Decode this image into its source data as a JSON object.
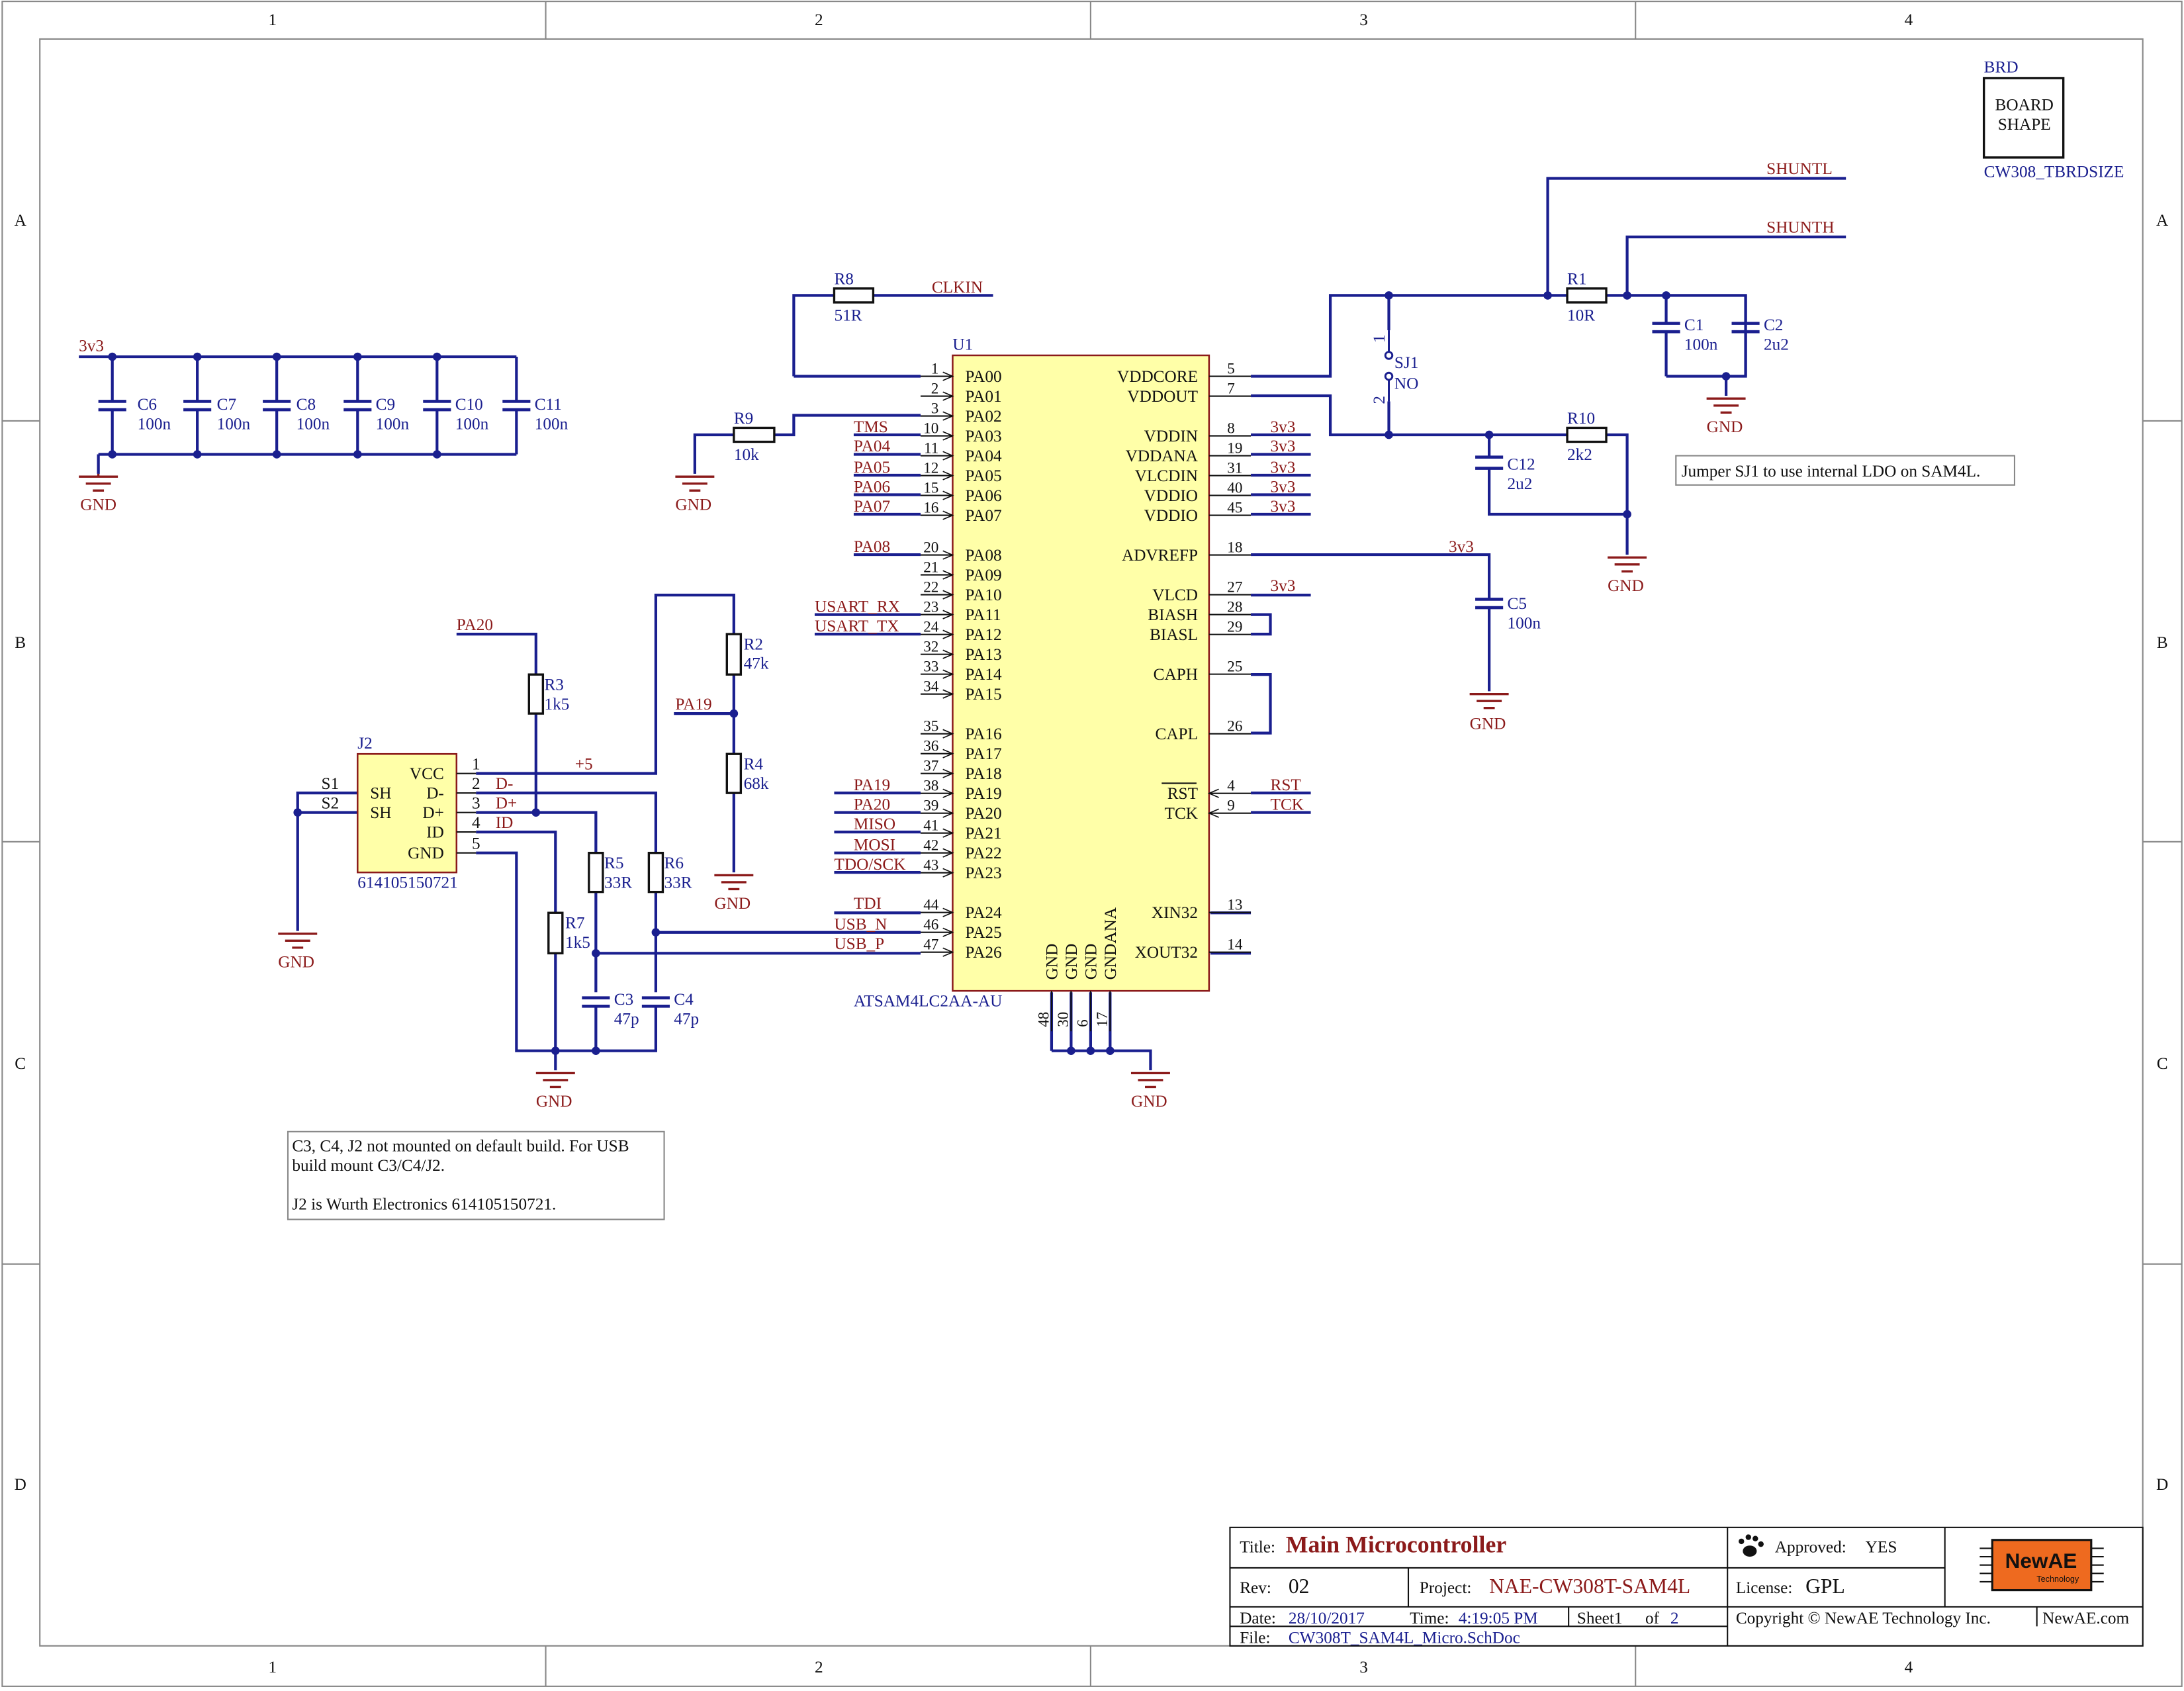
{
  "frame": {
    "cols": [
      "1",
      "2",
      "3",
      "4"
    ],
    "rows": [
      "A",
      "B",
      "C",
      "D"
    ]
  },
  "board": {
    "designator": "BRD",
    "line1": "BOARD",
    "line2": "SHAPE",
    "part": "CW308_TBRDSIZE"
  },
  "nets": {
    "v3v3": "3v3",
    "gnd": "GND",
    "clkin": "CLKIN",
    "shuntl": "SHUNTL",
    "shunth": "SHUNTH",
    "tms": "TMS",
    "pa04": "PA04",
    "pa05": "PA05",
    "pa06": "PA06",
    "pa07": "PA07",
    "pa08": "PA08",
    "usart_rx": "USART_RX",
    "usart_tx": "USART_TX",
    "pa19": "PA19",
    "pa20": "PA20",
    "miso": "MISO",
    "mosi": "MOSI",
    "tdo": "TDO/SCK",
    "tdi": "TDI",
    "usb_n": "USB_N",
    "usb_p": "USB_P",
    "rst": "RST",
    "tck": "TCK",
    "plus5": "+5",
    "dminus": "D-",
    "dplus": "D+",
    "id": "ID"
  },
  "decoupling": [
    {
      "ref": "C6",
      "value": "100n"
    },
    {
      "ref": "C7",
      "value": "100n"
    },
    {
      "ref": "C8",
      "value": "100n"
    },
    {
      "ref": "C9",
      "value": "100n"
    },
    {
      "ref": "C10",
      "value": "100n"
    },
    {
      "ref": "C11",
      "value": "100n"
    }
  ],
  "components": {
    "R8": {
      "ref": "R8",
      "value": "51R"
    },
    "R9": {
      "ref": "R9",
      "value": "10k"
    },
    "R2": {
      "ref": "R2",
      "value": "47k"
    },
    "R4": {
      "ref": "R4",
      "value": "68k"
    },
    "R3": {
      "ref": "R3",
      "value": "1k5"
    },
    "R5": {
      "ref": "R5",
      "value": "33R"
    },
    "R6": {
      "ref": "R6",
      "value": "33R"
    },
    "R7": {
      "ref": "R7",
      "value": "1k5"
    },
    "C3": {
      "ref": "C3",
      "value": "47p"
    },
    "C4": {
      "ref": "C4",
      "value": "47p"
    },
    "R1": {
      "ref": "R1",
      "value": "10R"
    },
    "C1": {
      "ref": "C1",
      "value": "100n"
    },
    "C2": {
      "ref": "C2",
      "value": "2u2"
    },
    "R10": {
      "ref": "R10",
      "value": "2k2"
    },
    "C12": {
      "ref": "C12",
      "value": "2u2"
    },
    "C5": {
      "ref": "C5",
      "value": "100n"
    },
    "SJ1": {
      "ref": "SJ1",
      "value": "NO",
      "pin1": "1",
      "pin2": "2"
    }
  },
  "u1": {
    "ref": "U1",
    "part": "ATSAM4LC2AA-AU",
    "left_pins": [
      {
        "num": "1",
        "name": "PA00"
      },
      {
        "num": "2",
        "name": "PA01"
      },
      {
        "num": "3",
        "name": "PA02"
      },
      {
        "num": "10",
        "name": "PA03"
      },
      {
        "num": "11",
        "name": "PA04"
      },
      {
        "num": "12",
        "name": "PA05"
      },
      {
        "num": "15",
        "name": "PA06"
      },
      {
        "num": "16",
        "name": "PA07"
      },
      {
        "num": "20",
        "name": "PA08"
      },
      {
        "num": "21",
        "name": "PA09"
      },
      {
        "num": "22",
        "name": "PA10"
      },
      {
        "num": "23",
        "name": "PA11"
      },
      {
        "num": "24",
        "name": "PA12"
      },
      {
        "num": "32",
        "name": "PA13"
      },
      {
        "num": "33",
        "name": "PA14"
      },
      {
        "num": "34",
        "name": "PA15"
      },
      {
        "num": "35",
        "name": "PA16"
      },
      {
        "num": "36",
        "name": "PA17"
      },
      {
        "num": "37",
        "name": "PA18"
      },
      {
        "num": "38",
        "name": "PA19"
      },
      {
        "num": "39",
        "name": "PA20"
      },
      {
        "num": "41",
        "name": "PA21"
      },
      {
        "num": "42",
        "name": "PA22"
      },
      {
        "num": "43",
        "name": "PA23"
      },
      {
        "num": "44",
        "name": "PA24"
      },
      {
        "num": "46",
        "name": "PA25"
      },
      {
        "num": "47",
        "name": "PA26"
      }
    ],
    "right_pins": [
      {
        "num": "5",
        "name": "VDDCORE"
      },
      {
        "num": "7",
        "name": "VDDOUT"
      },
      {
        "num": "8",
        "name": "VDDIN"
      },
      {
        "num": "19",
        "name": "VDDANA"
      },
      {
        "num": "31",
        "name": "VLCDIN"
      },
      {
        "num": "40",
        "name": "VDDIO"
      },
      {
        "num": "45",
        "name": "VDDIO"
      },
      {
        "num": "18",
        "name": "ADVREFP"
      },
      {
        "num": "27",
        "name": "VLCD"
      },
      {
        "num": "28",
        "name": "BIASH"
      },
      {
        "num": "29",
        "name": "BIASL"
      },
      {
        "num": "25",
        "name": "CAPH"
      },
      {
        "num": "26",
        "name": "CAPL"
      },
      {
        "num": "4",
        "name": "RST"
      },
      {
        "num": "9",
        "name": "TCK"
      },
      {
        "num": "13",
        "name": "XIN32"
      },
      {
        "num": "14",
        "name": "XOUT32"
      }
    ],
    "bottom_pins": [
      {
        "num": "48",
        "name": "GND"
      },
      {
        "num": "30",
        "name": "GND"
      },
      {
        "num": "6",
        "name": "GND"
      },
      {
        "num": "17",
        "name": "GNDANA"
      }
    ]
  },
  "j2": {
    "ref": "J2",
    "part": "614105150721",
    "pins": [
      {
        "num": "1",
        "name": "VCC"
      },
      {
        "num": "2",
        "name": "D-"
      },
      {
        "num": "3",
        "name": "D+"
      },
      {
        "num": "4",
        "name": "ID"
      },
      {
        "num": "5",
        "name": "GND"
      }
    ],
    "shield": [
      {
        "num": "S1",
        "name": "SH"
      },
      {
        "num": "S2",
        "name": "SH"
      }
    ]
  },
  "notes": {
    "jumper": "Jumper SJ1 to use internal LDO on SAM4L.",
    "usb_line1": "C3, C4, J2 not mounted on default build. For USB",
    "usb_line2": "build mount C3/C4/J2.",
    "usb_line3": "J2 is Wurth Electronics 614105150721."
  },
  "title_block": {
    "title_label": "Title:",
    "title": "Main Microcontroller",
    "approved_label": "Approved:",
    "approved": "YES",
    "rev_label": "Rev:",
    "rev": "02",
    "project_label": "Project:",
    "project": "NAE-CW308T-SAM4L",
    "license_label": "License:",
    "license": "GPL",
    "date_label": "Date:",
    "date": "28/10/2017",
    "time_label": "Time:",
    "time": "4:19:05 PM",
    "sheet_label": "Sheet1",
    "of_label": "of",
    "sheet_total": "2",
    "file_label": "File:",
    "file": "CW308T_SAM4L_Micro.SchDoc",
    "copyright": "Copyright © NewAE Technology Inc.",
    "site": "NewAE.com",
    "logo_main": "NewAE",
    "logo_sub": "Technology"
  },
  "colors": {
    "wire": "#1a1f8f",
    "net": "#8b1a1a",
    "chip_fill": "#ffffa8",
    "chip_stroke": "#8b1a1a",
    "logo": "#ee6a1f"
  }
}
